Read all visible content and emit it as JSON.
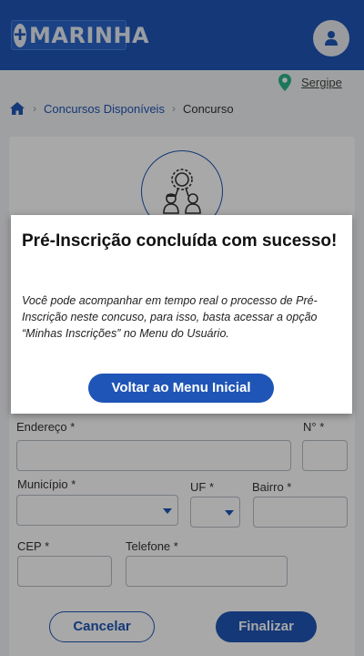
{
  "header": {
    "logo_plus": "+",
    "logo_text": "MARINHA",
    "user_icon": "user-icon"
  },
  "location": {
    "icon": "map-pin-icon",
    "label": "Sergipe"
  },
  "breadcrumb": {
    "home_icon": "home-icon",
    "items": [
      "Concursos Disponíveis",
      "Concurso"
    ],
    "separator": "›"
  },
  "form": {
    "address_label": "Endereço *",
    "number_label": "N° *",
    "city_label": "Município *",
    "uf_label": "UF *",
    "district_label": "Bairro *",
    "cep_label": "CEP *",
    "phone_label": "Telefone *",
    "cancel_label": "Cancelar",
    "finish_label": "Finalizar"
  },
  "modal": {
    "title": "Pré-Inscrição concluída com sucesso!",
    "message": "Você pode acompanhar em tempo real o processo de Pré-Inscrição neste concuso, para isso, basta acessar a opção “Minhas Inscrições”  no Menu do Usuário.",
    "button_label": "Voltar ao Menu Inicial"
  },
  "colors": {
    "primary": "#1f55b6",
    "location_pin": "#2bb58a"
  }
}
